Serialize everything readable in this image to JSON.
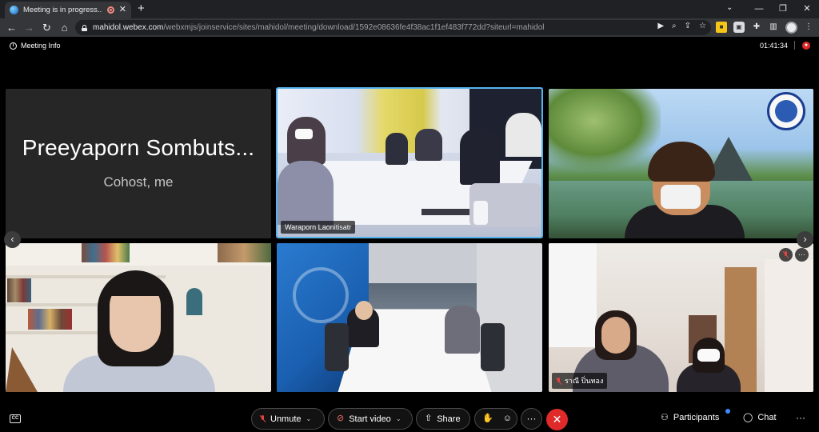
{
  "browser": {
    "tab_title": "Meeting is in progress...",
    "tab_close": "✕",
    "new_tab": "+",
    "url_host": "mahidol.webex.com",
    "url_path": "/webxmjs/joinservice/sites/mahidol/meeting/download/1592e08636fe4f38ac1f1ef483f772dd?siteurl=mahidol",
    "window_controls": [
      "—",
      "❐",
      "✕"
    ]
  },
  "meeting": {
    "info_label": "Meeting Info",
    "timer": "01:41:34"
  },
  "tiles": [
    {
      "name": "Preeyaporn Sombuts...",
      "role": "Cohost, me"
    },
    {
      "label": "Waraporn Laonitisatr"
    },
    {
      "label": ""
    },
    {
      "label": ""
    },
    {
      "label": ""
    },
    {
      "label": "ราณี ปิ่นทอง"
    }
  ],
  "controls": {
    "unmute": "Unmute",
    "start_video": "Start video",
    "share": "Share",
    "more": "···",
    "participants": "Participants",
    "chat": "Chat",
    "overflow": "···"
  },
  "colors": {
    "active_speaker_border": "#56b4ec",
    "end_call": "#e02a2a",
    "muted": "#e04444",
    "notification": "#3d8bfd"
  }
}
